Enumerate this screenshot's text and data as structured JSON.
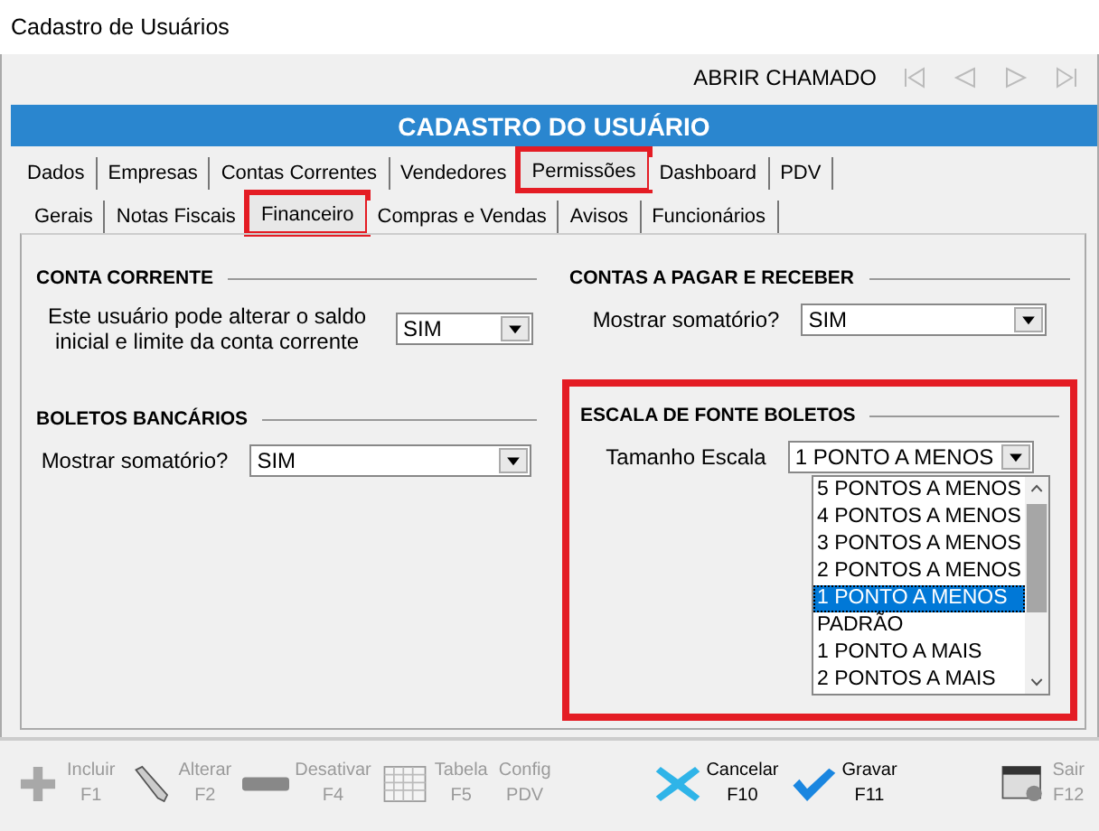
{
  "window": {
    "title": "Cadastro de Usuários"
  },
  "toolbar": {
    "link": "ABRIR CHAMADO"
  },
  "header": {
    "title": "CADASTRO DO USUÁRIO"
  },
  "tabs": [
    {
      "label": "Dados",
      "selected": false,
      "highlighted": false
    },
    {
      "label": "Empresas",
      "selected": false,
      "highlighted": false
    },
    {
      "label": "Contas Correntes",
      "selected": false,
      "highlighted": false
    },
    {
      "label": "Vendedores",
      "selected": false,
      "highlighted": false
    },
    {
      "label": "Permissões",
      "selected": true,
      "highlighted": true
    },
    {
      "label": "Dashboard",
      "selected": false,
      "highlighted": false
    },
    {
      "label": "PDV",
      "selected": false,
      "highlighted": false
    }
  ],
  "subtabs": [
    {
      "label": "Gerais",
      "selected": false,
      "highlighted": false
    },
    {
      "label": "Notas Fiscais",
      "selected": false,
      "highlighted": false
    },
    {
      "label": "Financeiro",
      "selected": true,
      "highlighted": true
    },
    {
      "label": "Compras e Vendas",
      "selected": false,
      "highlighted": false
    },
    {
      "label": "Avisos",
      "selected": false,
      "highlighted": false
    },
    {
      "label": "Funcionários",
      "selected": false,
      "highlighted": false
    }
  ],
  "sections": [
    {
      "title": "CONTA CORRENTE",
      "highlighted": false,
      "label": "Este usuário pode alterar o saldo inicial e limite da conta corrente",
      "value": "SIM"
    },
    {
      "title": "CONTAS A PAGAR E RECEBER",
      "highlighted": false,
      "label": "Mostrar somatório?",
      "value": "SIM"
    },
    {
      "title": "BOLETOS BANCÁRIOS",
      "highlighted": false,
      "label": "Mostrar somatório?",
      "value": "SIM"
    },
    {
      "title": "ESCALA DE FONTE BOLETOS",
      "highlighted": true,
      "label": "Tamanho Escala",
      "value": "1 PONTO A MENOS",
      "options": [
        {
          "label": "5 PONTOS A MENOS",
          "selected": false
        },
        {
          "label": "4 PONTOS A MENOS",
          "selected": false
        },
        {
          "label": "3 PONTOS A MENOS",
          "selected": false
        },
        {
          "label": "2 PONTOS A MENOS",
          "selected": false
        },
        {
          "label": "1 PONTO A MENOS",
          "selected": true
        },
        {
          "label": "PADRÃO",
          "selected": false
        },
        {
          "label": "1 PONTO A MAIS",
          "selected": false
        },
        {
          "label": "2 PONTOS A MAIS",
          "selected": false
        }
      ]
    }
  ],
  "footer_buttons": [
    {
      "kind": "plus",
      "label": "Incluir",
      "key": "F1",
      "disabled": true
    },
    {
      "kind": "pencil",
      "label": "Alterar",
      "key": "F2",
      "disabled": true
    },
    {
      "kind": "minus",
      "label": "Desativar",
      "key": "F4",
      "disabled": true
    },
    {
      "kind": "table",
      "label": "Tabela",
      "key": "F5",
      "disabled": true
    },
    {
      "kind": "none",
      "label": "Config",
      "key": "PDV",
      "disabled": true
    },
    {
      "kind": "cross",
      "label": "Cancelar",
      "key": "F10",
      "disabled": false
    },
    {
      "kind": "check",
      "label": "Gravar",
      "key": "F11",
      "disabled": false
    },
    {
      "kind": "exit",
      "label": "Sair",
      "key": "F12",
      "disabled": true
    }
  ]
}
